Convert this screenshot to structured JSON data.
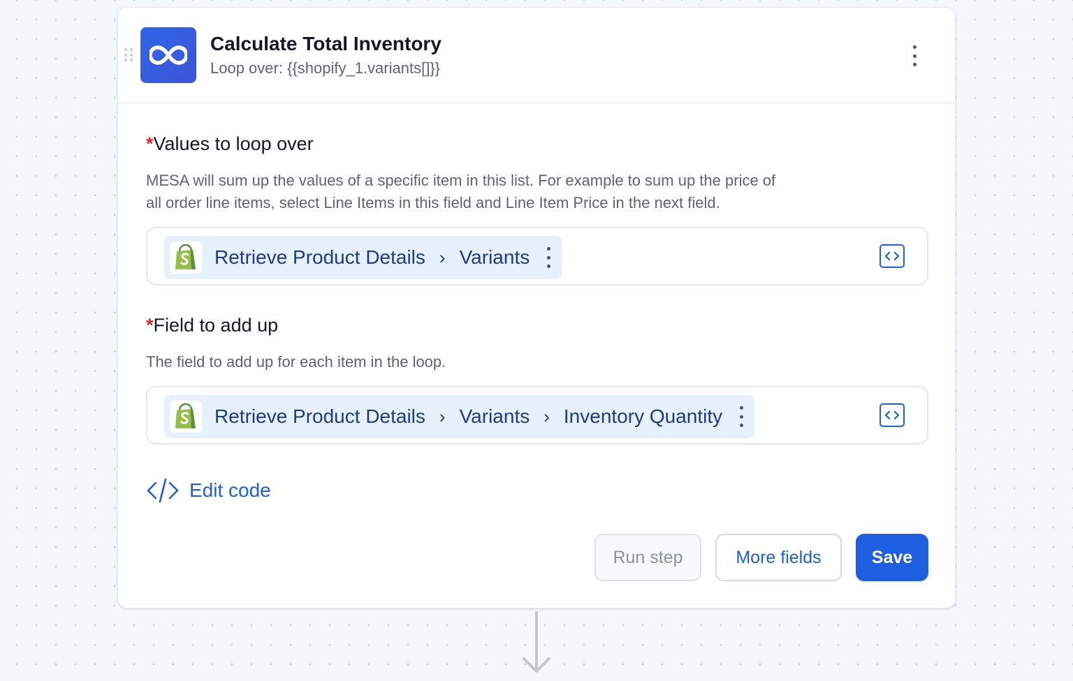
{
  "step": {
    "title": "Calculate Total Inventory",
    "subtitle": "Loop over: {{shopify_1.variants[]}}",
    "icon": "loop-infinity-icon",
    "icon_color": "#2e66e8"
  },
  "fields": [
    {
      "required_mark": "*",
      "label": "Values to loop over",
      "description_line1": "MESA will sum up the values of a specific item in this list. For example to sum up the price of",
      "description_line2": "all order line items, select Line Items in this field and Line Item Price in the next field.",
      "token": {
        "icon": "shopify-icon",
        "parts": [
          "Retrieve Product Details",
          "Variants"
        ]
      }
    },
    {
      "required_mark": "*",
      "label": "Field to add up",
      "description_line1": "The field to add up for each item in the loop.",
      "token": {
        "icon": "shopify-icon",
        "parts": [
          "Retrieve Product Details",
          "Variants",
          "Inventory Quantity"
        ]
      }
    }
  ],
  "edit_code_label": "Edit code",
  "buttons": {
    "run_step": "Run step",
    "more_fields": "More fields",
    "save": "Save"
  },
  "colors": {
    "accent": "#1d5fe0",
    "token_bg": "#e7f0fd",
    "required": "#e02424"
  }
}
